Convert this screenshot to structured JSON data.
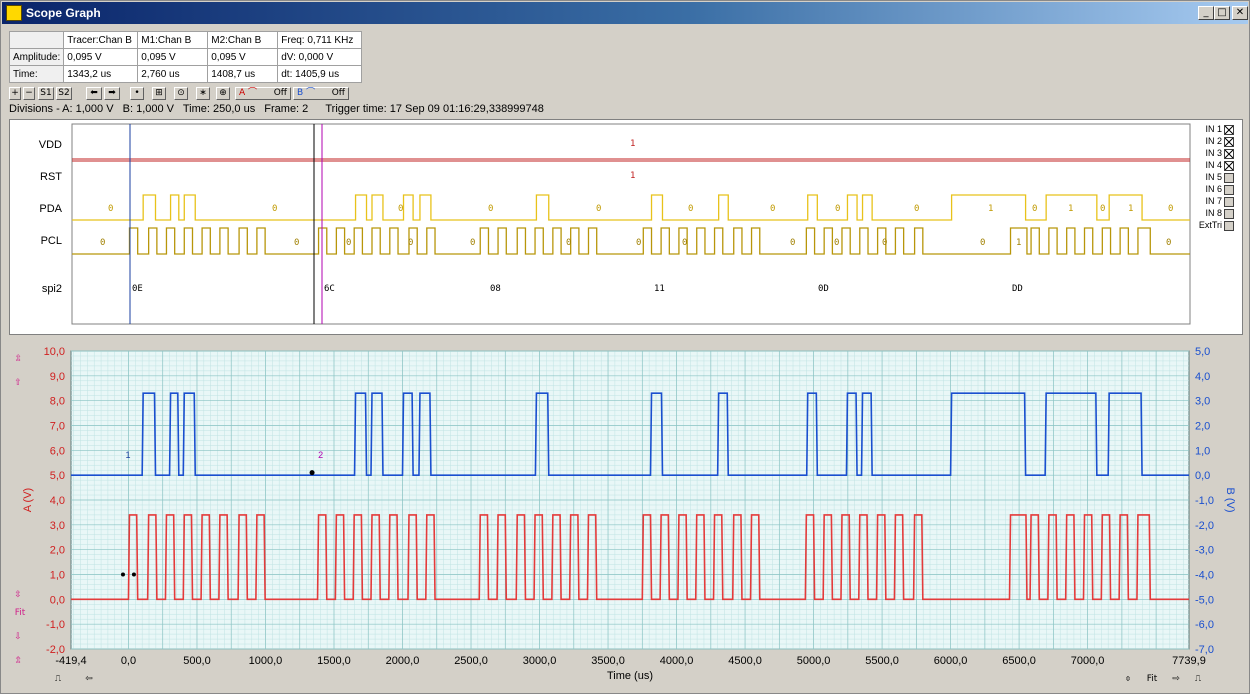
{
  "window": {
    "title": "Scope Graph",
    "controls": [
      "_",
      "□",
      "✕"
    ]
  },
  "measurements": {
    "columns": [
      "",
      "Tracer:Chan B",
      "M1:Chan B",
      "M2:Chan B",
      "Freq: 0,711 KHz"
    ],
    "rows": [
      {
        "label": "Amplitude:",
        "tracer": "0,095 V",
        "m1": "0,095 V",
        "m2": "0,095 V",
        "extra": "dV: 0,000 V"
      },
      {
        "label": "Time:",
        "tracer": "1343,2 us",
        "m1": "2,760 us",
        "m2": "1408,7 us",
        "extra": "dt:  1405,9 us"
      }
    ]
  },
  "toolbar": {
    "buttons": [
      "+",
      "−",
      "S1",
      "S2",
      "⬅",
      "➡",
      "•",
      "⊞",
      "⊙",
      "∗",
      "⊕"
    ],
    "chanA_label": "A",
    "chanA_state": "Off",
    "chanB_label": "B",
    "chanB_state": "Off"
  },
  "info": {
    "divisions": "Divisions -  A: 1,000 V",
    "b_div": "B: 1,000 V",
    "time_div": "Time: 250,0 us",
    "frame": "Frame: 2",
    "trigger": "Trigger time: 17 Sep 09 01:16:29,338999748"
  },
  "logic": {
    "channels": [
      "VDD",
      "RST",
      "PDA",
      "PCL",
      "spi2"
    ],
    "vdd_label": "1",
    "rst_label": "1",
    "pda_labels": [
      "0",
      "0",
      "0",
      "0",
      "0",
      "0",
      "0",
      "0",
      "0",
      "1",
      "0",
      "1",
      "0",
      "1",
      "0"
    ],
    "pcl_labels": [
      "0",
      "0",
      "0",
      "0",
      "0",
      "0",
      "0",
      "0",
      "0",
      "0",
      "0",
      "0",
      "1",
      "0"
    ],
    "spi_labels": [
      "0E",
      "6C",
      "08",
      "11",
      "0D",
      "DD"
    ],
    "inputs": [
      {
        "name": "IN 1",
        "checked": true
      },
      {
        "name": "IN 2",
        "checked": true
      },
      {
        "name": "IN 3",
        "checked": true
      },
      {
        "name": "IN 4",
        "checked": true
      },
      {
        "name": "IN 5",
        "checked": false
      },
      {
        "name": "IN 6",
        "checked": false
      },
      {
        "name": "IN 7",
        "checked": false
      },
      {
        "name": "IN 8",
        "checked": false
      },
      {
        "name": "ExtTri",
        "checked": false
      }
    ]
  },
  "chart_data": {
    "type": "line",
    "xlabel": "Time (us)",
    "ylabel_left": "A (V)",
    "ylabel_right": "B (V)",
    "xlim": [
      -419.4,
      7739.9
    ],
    "ylim_left": [
      -2,
      10
    ],
    "ylim_right": [
      -7,
      5
    ],
    "x_ticks": [
      "-419,4",
      "0,0",
      "500,0",
      "1000,0",
      "1500,0",
      "2000,0",
      "2500,0",
      "3000,0",
      "3500,0",
      "4000,0",
      "4500,0",
      "5000,0",
      "5500,0",
      "6000,0",
      "6500,0",
      "7000,0",
      "7739,9"
    ],
    "y_ticks_left": [
      "10,0",
      "9,0",
      "8,0",
      "7,0",
      "6,0",
      "5,0",
      "4,0",
      "3,0",
      "2,0",
      "1,0",
      "0,0",
      "-1,0",
      "-2,0"
    ],
    "y_ticks_right": [
      "5,0",
      "4,0",
      "3,0",
      "2,0",
      "1,0",
      "0,0",
      "-1,0",
      "-2,0",
      "-3,0",
      "-4,0",
      "-5,0",
      "-6,0",
      "-7,0"
    ],
    "grid": true,
    "markers": [
      {
        "label": "1",
        "x": 0
      },
      {
        "label": "2",
        "x": 1406
      }
    ],
    "series": [
      {
        "name": "B",
        "color": "#1a4fcf",
        "baseline": 5.0,
        "high": 8.3,
        "pulses": [
          [
            100,
            190
          ],
          [
            300,
            360
          ],
          [
            400,
            480
          ],
          [
            1650,
            1730
          ],
          [
            1770,
            1850
          ],
          [
            2000,
            2070
          ],
          [
            2120,
            2200
          ],
          [
            2970,
            3060
          ],
          [
            3810,
            3890
          ],
          [
            4300,
            4370
          ],
          [
            4950,
            5020
          ],
          [
            5240,
            5310
          ],
          [
            5350,
            5420
          ],
          [
            6000,
            6540
          ],
          [
            6690,
            7060
          ],
          [
            7150,
            7390
          ]
        ]
      },
      {
        "name": "A",
        "color": "#e43b3b",
        "baseline": 0.0,
        "high": 3.4,
        "pulses": [
          [
            0,
            60
          ],
          [
            140,
            200
          ],
          [
            270,
            330
          ],
          [
            400,
            460
          ],
          [
            530,
            590
          ],
          [
            660,
            720
          ],
          [
            800,
            860
          ],
          [
            930,
            990
          ],
          [
            1380,
            1440
          ],
          [
            1510,
            1570
          ],
          [
            1640,
            1700
          ],
          [
            1770,
            1830
          ],
          [
            1900,
            1960
          ],
          [
            2040,
            2100
          ],
          [
            2170,
            2230
          ],
          [
            2560,
            2620
          ],
          [
            2690,
            2750
          ],
          [
            2830,
            2890
          ],
          [
            2960,
            3020
          ],
          [
            3090,
            3150
          ],
          [
            3220,
            3280
          ],
          [
            3350,
            3410
          ],
          [
            3750,
            3810
          ],
          [
            3880,
            3940
          ],
          [
            4010,
            4070
          ],
          [
            4140,
            4200
          ],
          [
            4270,
            4330
          ],
          [
            4410,
            4470
          ],
          [
            4540,
            4600
          ],
          [
            4940,
            5000
          ],
          [
            5070,
            5130
          ],
          [
            5200,
            5260
          ],
          [
            5330,
            5390
          ],
          [
            5460,
            5520
          ],
          [
            5590,
            5650
          ],
          [
            5730,
            5790
          ],
          [
            6430,
            6550
          ],
          [
            6580,
            6640
          ],
          [
            6710,
            6770
          ],
          [
            6840,
            6900
          ],
          [
            6970,
            7030
          ],
          [
            7100,
            7160
          ],
          [
            7230,
            7290
          ],
          [
            7360,
            7450
          ]
        ]
      }
    ]
  },
  "left_tools": [
    "⇫",
    "⇧",
    "⇳",
    "Fit",
    "⇩",
    "⇬"
  ],
  "bottom_tools": {
    "fit_label": "Fit"
  }
}
